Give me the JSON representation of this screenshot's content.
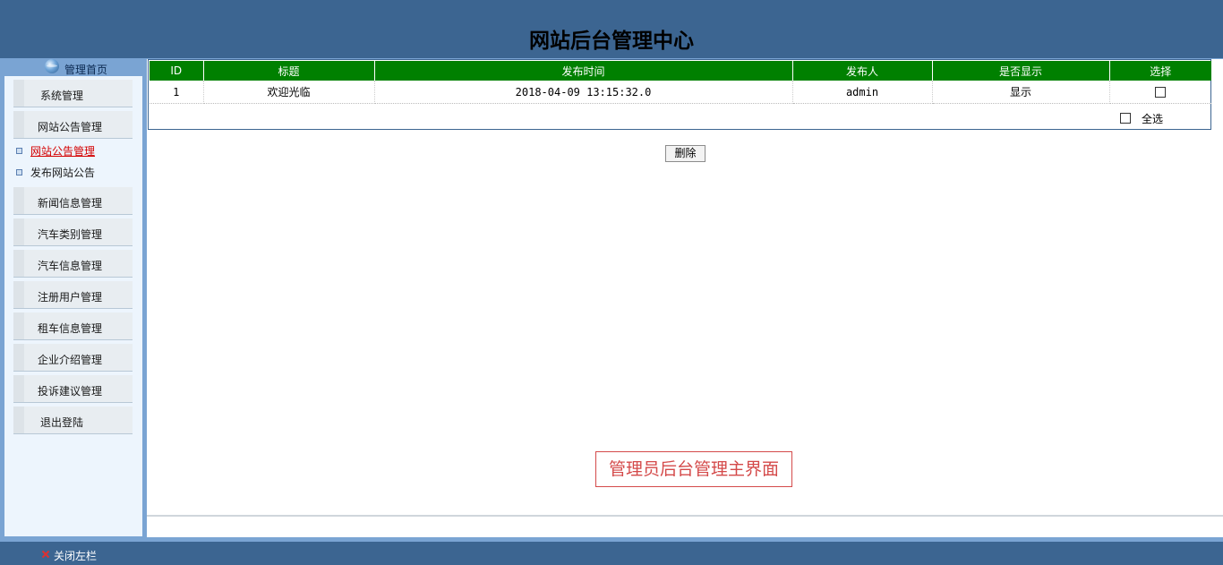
{
  "header": {
    "title": "网站后台管理中心"
  },
  "sidebar": {
    "home_label": "管理首页",
    "items": [
      {
        "label": "系统管理"
      },
      {
        "label": "网站公告管理"
      },
      {
        "label": "新闻信息管理"
      },
      {
        "label": "汽车类别管理"
      },
      {
        "label": "汽车信息管理"
      },
      {
        "label": "注册用户管理"
      },
      {
        "label": "租车信息管理"
      },
      {
        "label": "企业介绍管理"
      },
      {
        "label": "投诉建议管理"
      },
      {
        "label": "退出登陆"
      }
    ],
    "subitems": [
      {
        "label": "网站公告管理",
        "active": true
      },
      {
        "label": "发布网站公告",
        "active": false
      }
    ]
  },
  "table": {
    "columns": [
      "ID",
      "标题",
      "发布时间",
      "发布人",
      "是否显示",
      "选择"
    ],
    "rows": [
      {
        "id": "1",
        "title": "欢迎光临",
        "time": "2018-04-09 13:15:32.0",
        "publisher": "admin",
        "display": "显示"
      }
    ],
    "select_all_label": "全选"
  },
  "actions": {
    "delete_label": "删除"
  },
  "watermark": "管理员后台管理主界面",
  "footer": {
    "close_label": "关闭左栏"
  },
  "colors": {
    "header_bg": "#3c6591",
    "table_header_bg": "#008000",
    "sidebar_bg": "#7aa4d3",
    "active_link": "#d40000"
  }
}
